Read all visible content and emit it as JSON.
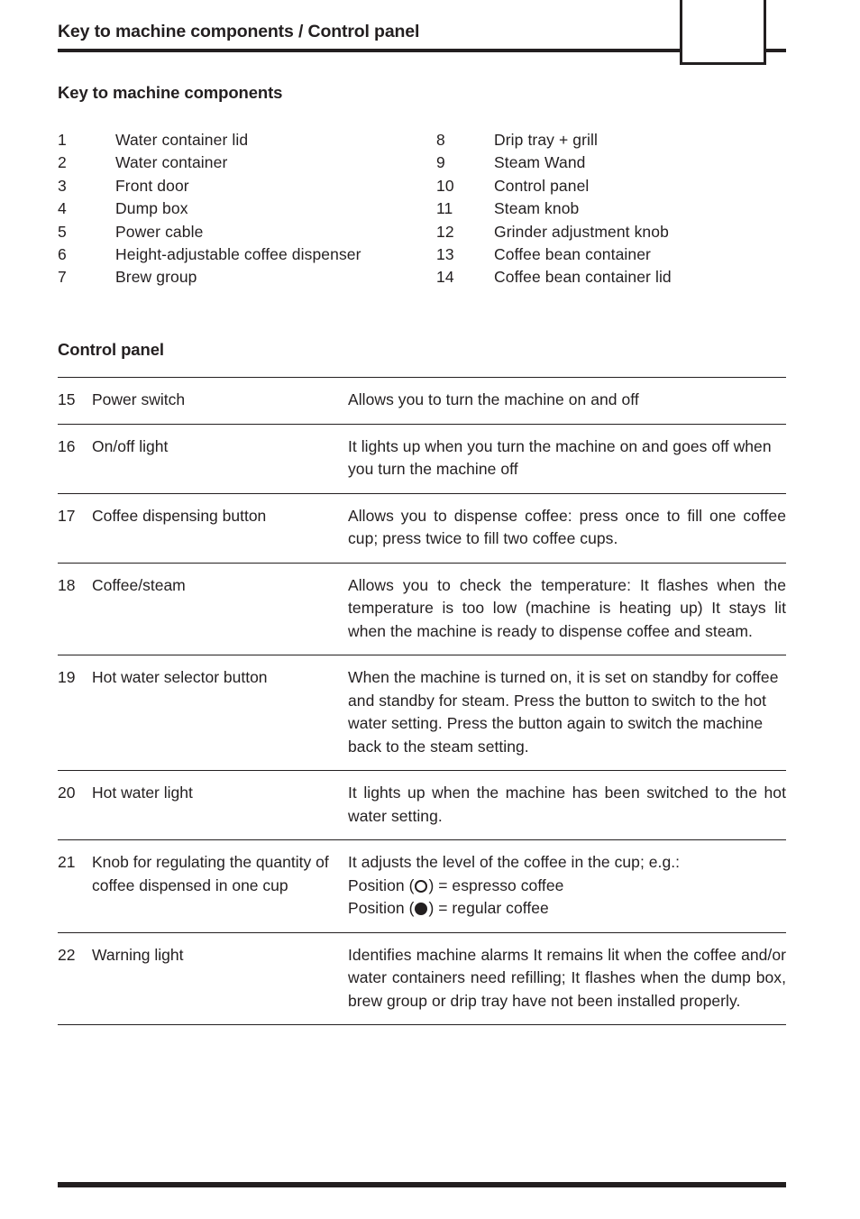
{
  "header": {
    "title": "Key to machine components / Control panel",
    "page_number": ""
  },
  "key_section": {
    "title": "Key to machine components",
    "left_column": [
      {
        "num": "1",
        "label": "Water container lid"
      },
      {
        "num": "2",
        "label": "Water container"
      },
      {
        "num": "3",
        "label": "Front door"
      },
      {
        "num": "4",
        "label": "Dump box"
      },
      {
        "num": "5",
        "label": "Power cable"
      },
      {
        "num": "6",
        "label": "Height-adjustable coffee dispenser"
      },
      {
        "num": "7",
        "label": "Brew group"
      }
    ],
    "right_column": [
      {
        "num": "8",
        "label": "Drip tray + grill"
      },
      {
        "num": "9",
        "label": "Steam Wand"
      },
      {
        "num": "10",
        "label": "Control panel"
      },
      {
        "num": "11",
        "label": "Steam knob"
      },
      {
        "num": "12",
        "label": "Grinder adjustment knob"
      },
      {
        "num": "13",
        "label": "Coffee bean container"
      },
      {
        "num": "14",
        "label": "Coffee bean container lid"
      }
    ]
  },
  "control_panel": {
    "title": "Control panel",
    "rows": [
      {
        "num": "15",
        "term": "Power switch",
        "desc": "Allows you to turn the machine on and off"
      },
      {
        "num": "16",
        "term": "On/off light",
        "desc": "It lights up when you turn the machine on and goes off when you turn the machine off"
      },
      {
        "num": "17",
        "term": "Coffee dispensing button",
        "desc": "Allows you to dispense coffee: press once to fill one coffee cup; press twice to fill two coffee cups."
      },
      {
        "num": "18",
        "term": "Coffee/steam",
        "desc": "Allows you to check the temperature: It flashes when the temperature is too low (machine is heating up) It stays lit when the machine is ready to dispense coffee and steam."
      },
      {
        "num": "19",
        "term": "Hot water selector button",
        "desc": "When the machine is turned on, it is set on standby for coffee and standby for steam. Press the button to switch to the hot water setting. Press the button again to switch the machine back to the steam setting."
      },
      {
        "num": "20",
        "term": "Hot water light",
        "desc": "It lights up when the machine has been switched to the hot water setting."
      },
      {
        "num": "21",
        "term": "Knob for regulating the quantity of coffee dispensed in one cup",
        "desc_intro": "It adjusts the level of the coffee in the cup; e.g.:",
        "position_open_prefix": "Position (",
        "position_open_suffix": ") = espresso coffee",
        "position_filled_prefix": "Position (",
        "position_filled_suffix": ") = regular coffee"
      },
      {
        "num": "22",
        "term": "Warning light",
        "desc": "Identifies machine alarms It remains lit when the coffee and/or water containers need refilling; It flashes when the dump box, brew group or drip tray have not been installed properly."
      }
    ]
  }
}
